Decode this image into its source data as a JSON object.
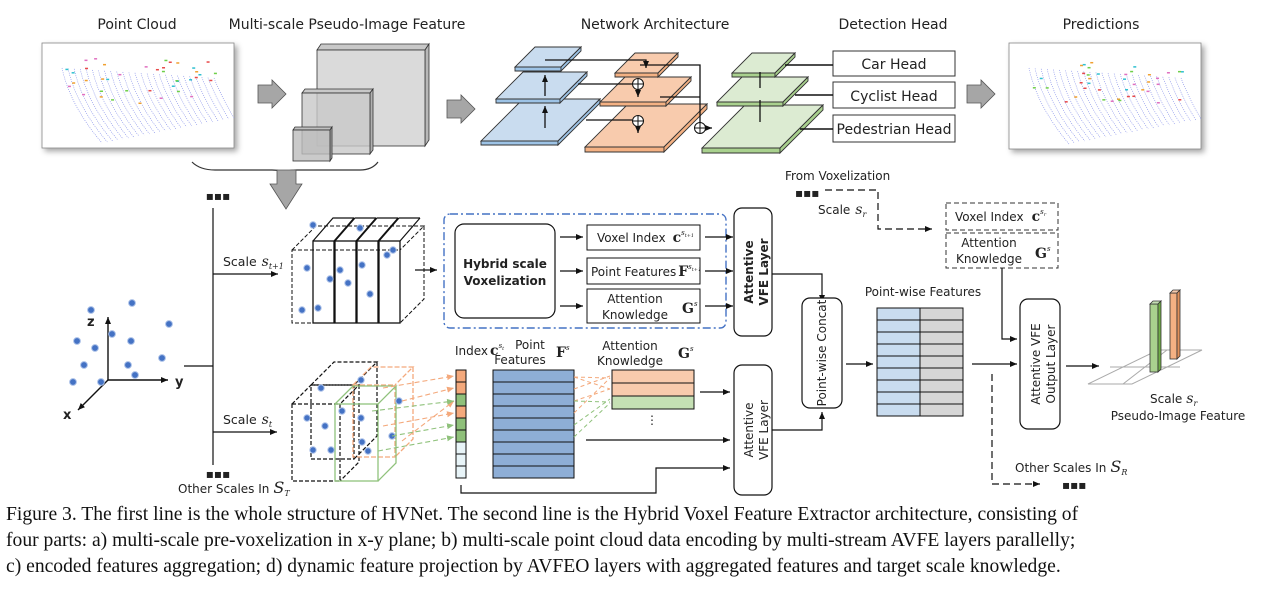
{
  "top_row": {
    "point_cloud_title": "Point Cloud",
    "pseudo_image_title": "Multi-scale Pseudo-Image Feature",
    "network_title": "Network Architecture",
    "detection_title": "Detection Head",
    "predictions_title": "Predictions",
    "heads": [
      "Car Head",
      "Cyclist Head",
      "Pedestrian Head"
    ]
  },
  "hvfe": {
    "ellipsis": "▪▪▪",
    "axes": {
      "x": "x",
      "y": "y",
      "z": "z"
    },
    "scale_upper": {
      "prefix": "Scale",
      "symbol": "s",
      "sub": "t+1"
    },
    "scale_lower": {
      "prefix": "Scale",
      "symbol": "s",
      "sub": "t"
    },
    "other_scales_T": {
      "prefix": "Other Scales In",
      "symbol": "S",
      "sub": "T"
    },
    "hybrid_voxelization": [
      "Hybrid scale",
      "Voxelization"
    ],
    "voxel_index": "Voxel Index",
    "point_features": "Point Features",
    "attention_knowledge": [
      "Attention",
      "Knowledge"
    ],
    "index_label": "Index",
    "point_features_lower": [
      "Point",
      "Features"
    ],
    "attention_lower": [
      "Attention",
      "Knowledge"
    ],
    "attentive_vfe": [
      "Attentive",
      "VFE Layer"
    ],
    "pointwise_concat": "Point-wise Concat",
    "pointwise_features": "Point-wise Features",
    "from_voxelization": "From  Voxelization",
    "scale_r": {
      "prefix": "Scale",
      "symbol": "s",
      "sub": "r"
    },
    "target_voxel_index": "Voxel Index",
    "target_attention": [
      "Attention",
      "Knowledge"
    ],
    "output_layer": [
      "Attentive VFE",
      "Output Layer"
    ],
    "pseudo_image_feature": "Pseudo-Image Feature",
    "other_scales_R": {
      "prefix": "Other Scales In",
      "symbol": "S",
      "sub": "R"
    },
    "sym_c": "c",
    "sym_F": "F",
    "sym_G": "G",
    "index_colors": [
      "#f4a97c",
      "#f4a97c",
      "#8fc07a",
      "#f4a97c",
      "#8fc07a",
      "#8fc07a",
      "#e8f4f8",
      "#e8f4f8",
      "#e8f4f8"
    ],
    "attention_colors": [
      "#f8cbad",
      "#f8cbad",
      "#c5e0b4"
    ]
  },
  "colors": {
    "blue_layer": "#c9dcef",
    "orange_layer": "#f8cbad",
    "green_layer": "#dcebd2",
    "point_blue": "#4472c4",
    "feature_blue": "#8eaed6",
    "dash_blue": "#4472c4",
    "orange_dash": "#f4a97c",
    "green_dash": "#90c27c"
  },
  "caption": [
    "Figure 3. The first line is the whole structure of HVNet. The second line is the Hybrid Voxel Feature Extractor architecture, consisting of",
    "four parts: a) multi-scale pre-voxelization in x-y plane; b) multi-scale point cloud data encoding by multi-stream AVFE layers parallelly;",
    "c) encoded features aggregation; d) dynamic feature projection by AVFEO layers with aggregated features and target scale knowledge."
  ]
}
